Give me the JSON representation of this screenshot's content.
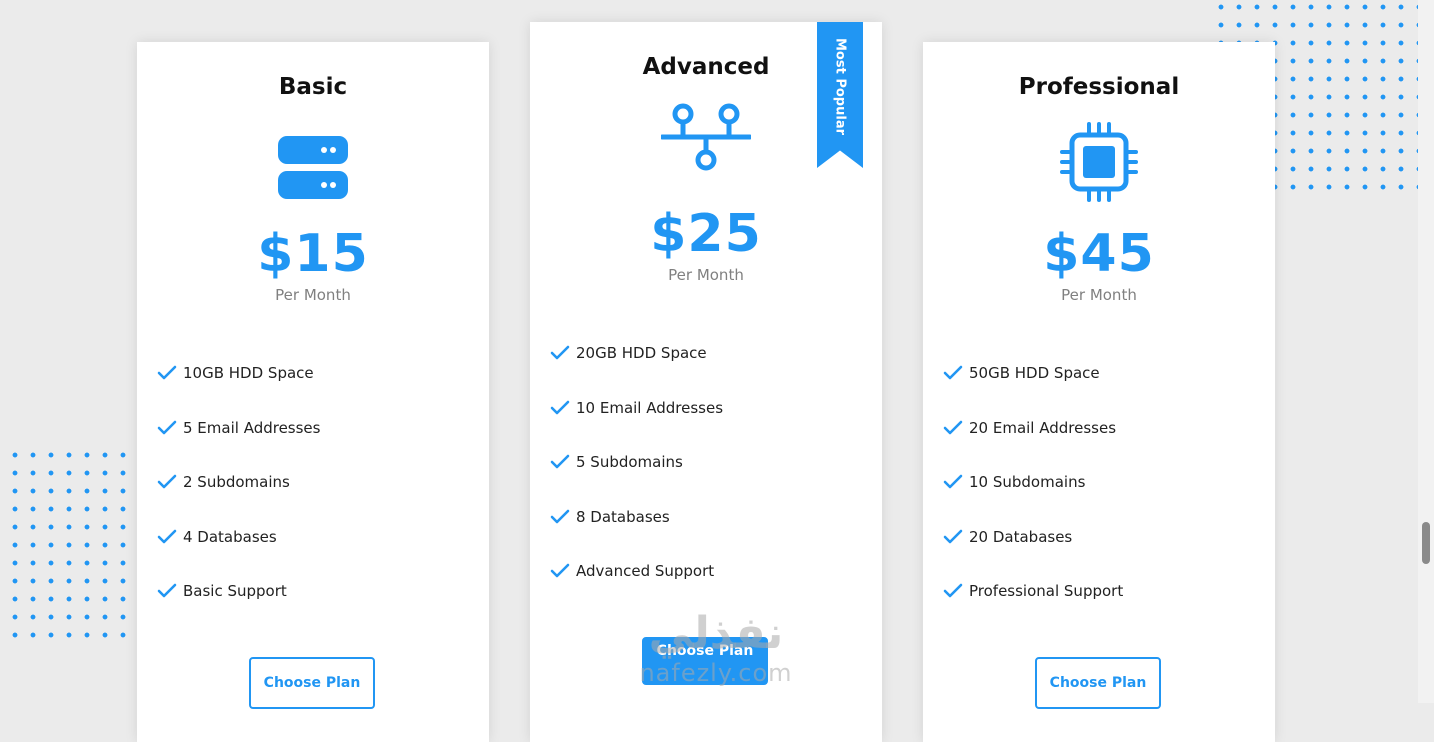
{
  "colors": {
    "accent": "#2196f3",
    "background": "#ebebeb",
    "card": "#ffffff"
  },
  "plans": [
    {
      "name": "Basic",
      "icon": "server-icon",
      "price": "$15",
      "period": "Per Month",
      "features": [
        "10GB HDD Space",
        "5 Email Addresses",
        "2 Subdomains",
        "4 Databases",
        "Basic Support"
      ],
      "button_label": "Choose Plan"
    },
    {
      "name": "Advanced",
      "icon": "network-icon",
      "price": "$25",
      "period": "Per Month",
      "ribbon": "Most Popular",
      "features": [
        "20GB HDD Space",
        "10 Email Addresses",
        "5 Subdomains",
        "8 Databases",
        "Advanced Support"
      ],
      "button_label": "Choose Plan"
    },
    {
      "name": "Professional",
      "icon": "cpu-chip-icon",
      "price": "$45",
      "period": "Per Month",
      "features": [
        "50GB HDD Space",
        "20 Email Addresses",
        "10 Subdomains",
        "20 Databases",
        "Professional Support"
      ],
      "button_label": "Choose Plan"
    }
  ],
  "watermark": {
    "arabic": "نفذلي",
    "latin": "nafezly.com"
  }
}
